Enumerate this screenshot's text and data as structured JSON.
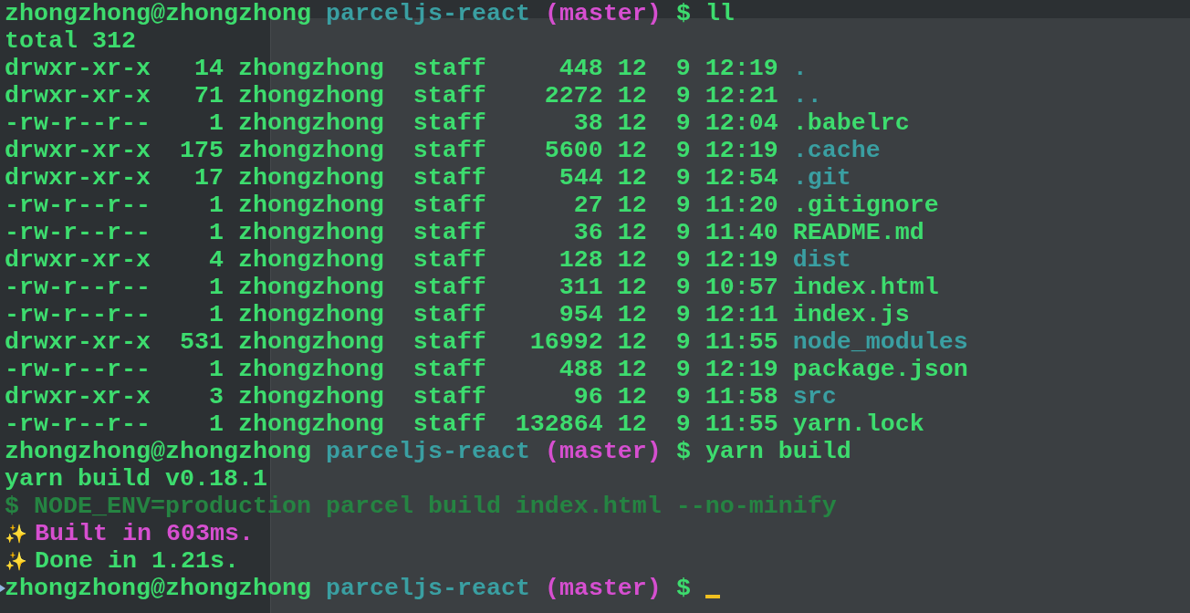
{
  "terminal": {
    "lines": [
      {
        "kind": "prompt",
        "user": "zhongzhong@zhongzhong",
        "dir": "parceljs-react",
        "branch": "(master)",
        "symbol": "$",
        "command": "ll",
        "cursor": false
      },
      {
        "kind": "output",
        "dimmed": false,
        "highlighted": false,
        "text": "total 312"
      },
      {
        "kind": "entry",
        "is_directory": true,
        "perms": "drwxr-xr-x",
        "links": "14",
        "owner": "zhongzhong",
        "group": "staff",
        "size": "448",
        "month": "12",
        "day": "9",
        "time": "12:19",
        "name": "."
      },
      {
        "kind": "entry",
        "is_directory": true,
        "perms": "drwxr-xr-x",
        "links": "71",
        "owner": "zhongzhong",
        "group": "staff",
        "size": "2272",
        "month": "12",
        "day": "9",
        "time": "12:21",
        "name": ".."
      },
      {
        "kind": "entry",
        "is_directory": false,
        "perms": "-rw-r--r--",
        "links": "1",
        "owner": "zhongzhong",
        "group": "staff",
        "size": "38",
        "month": "12",
        "day": "9",
        "time": "12:04",
        "name": ".babelrc"
      },
      {
        "kind": "entry",
        "is_directory": true,
        "perms": "drwxr-xr-x",
        "links": "175",
        "owner": "zhongzhong",
        "group": "staff",
        "size": "5600",
        "month": "12",
        "day": "9",
        "time": "12:19",
        "name": ".cache"
      },
      {
        "kind": "entry",
        "is_directory": true,
        "perms": "drwxr-xr-x",
        "links": "17",
        "owner": "zhongzhong",
        "group": "staff",
        "size": "544",
        "month": "12",
        "day": "9",
        "time": "12:54",
        "name": ".git"
      },
      {
        "kind": "entry",
        "is_directory": false,
        "perms": "-rw-r--r--",
        "links": "1",
        "owner": "zhongzhong",
        "group": "staff",
        "size": "27",
        "month": "12",
        "day": "9",
        "time": "11:20",
        "name": ".gitignore"
      },
      {
        "kind": "entry",
        "is_directory": false,
        "perms": "-rw-r--r--",
        "links": "1",
        "owner": "zhongzhong",
        "group": "staff",
        "size": "36",
        "month": "12",
        "day": "9",
        "time": "11:40",
        "name": "README.md"
      },
      {
        "kind": "entry",
        "is_directory": true,
        "perms": "drwxr-xr-x",
        "links": "4",
        "owner": "zhongzhong",
        "group": "staff",
        "size": "128",
        "month": "12",
        "day": "9",
        "time": "12:19",
        "name": "dist"
      },
      {
        "kind": "entry",
        "is_directory": false,
        "perms": "-rw-r--r--",
        "links": "1",
        "owner": "zhongzhong",
        "group": "staff",
        "size": "311",
        "month": "12",
        "day": "9",
        "time": "10:57",
        "name": "index.html"
      },
      {
        "kind": "entry",
        "is_directory": false,
        "perms": "-rw-r--r--",
        "links": "1",
        "owner": "zhongzhong",
        "group": "staff",
        "size": "954",
        "month": "12",
        "day": "9",
        "time": "12:11",
        "name": "index.js"
      },
      {
        "kind": "entry",
        "is_directory": true,
        "perms": "drwxr-xr-x",
        "links": "531",
        "owner": "zhongzhong",
        "group": "staff",
        "size": "16992",
        "month": "12",
        "day": "9",
        "time": "11:55",
        "name": "node_modules"
      },
      {
        "kind": "entry",
        "is_directory": false,
        "perms": "-rw-r--r--",
        "links": "1",
        "owner": "zhongzhong",
        "group": "staff",
        "size": "488",
        "month": "12",
        "day": "9",
        "time": "12:19",
        "name": "package.json"
      },
      {
        "kind": "entry",
        "is_directory": true,
        "perms": "drwxr-xr-x",
        "links": "3",
        "owner": "zhongzhong",
        "group": "staff",
        "size": "96",
        "month": "12",
        "day": "9",
        "time": "11:58",
        "name": "src"
      },
      {
        "kind": "entry",
        "is_directory": false,
        "perms": "-rw-r--r--",
        "links": "1",
        "owner": "zhongzhong",
        "group": "staff",
        "size": "132864",
        "month": "12",
        "day": "9",
        "time": "11:55",
        "name": "yarn.lock"
      },
      {
        "kind": "prompt",
        "user": "zhongzhong@zhongzhong",
        "dir": "parceljs-react",
        "branch": "(master)",
        "symbol": "$",
        "command": "yarn build",
        "cursor": false
      },
      {
        "kind": "output",
        "dimmed": false,
        "highlighted": false,
        "text": "yarn build v0.18.1"
      },
      {
        "kind": "output",
        "dimmed": true,
        "highlighted": false,
        "text": "$ NODE_ENV=production parcel build index.html --no-minify"
      },
      {
        "kind": "output",
        "dimmed": false,
        "highlighted": true,
        "icon": "✨",
        "text": "Built in 603ms."
      },
      {
        "kind": "output",
        "dimmed": false,
        "highlighted": false,
        "icon": "✨",
        "text": "Done in 1.21s."
      },
      {
        "kind": "prompt",
        "user": "zhongzhong@zhongzhong",
        "dir": "parceljs-react",
        "branch": "(master)",
        "symbol": "$",
        "cursor": true
      }
    ]
  }
}
